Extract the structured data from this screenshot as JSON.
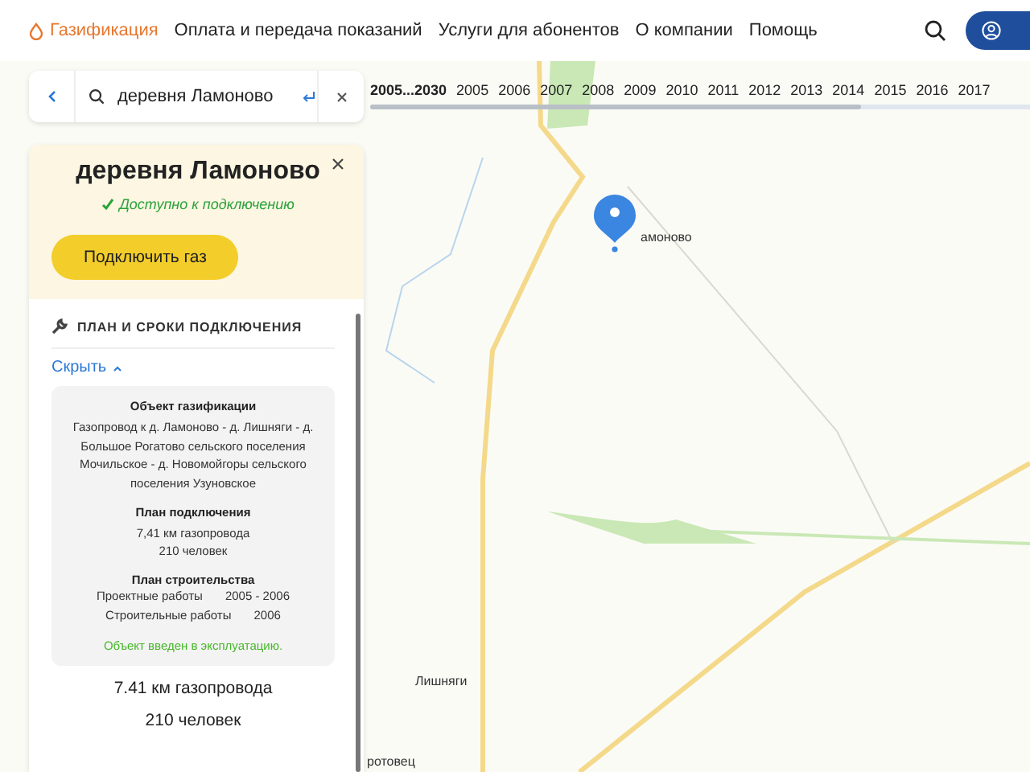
{
  "nav": {
    "items": [
      {
        "label": "Газификация",
        "selected": true
      },
      {
        "label": "Оплата и передача показаний",
        "selected": false
      },
      {
        "label": "Услуги для абонентов",
        "selected": false
      },
      {
        "label": "О компании",
        "selected": false
      },
      {
        "label": "Помощь",
        "selected": false
      }
    ]
  },
  "search": {
    "value": "деревня Ламоново"
  },
  "timeline": {
    "years": [
      {
        "label": "2005...2030",
        "selected": true
      },
      {
        "label": "2005",
        "selected": false
      },
      {
        "label": "2006",
        "selected": false
      },
      {
        "label": "2007",
        "selected": false
      },
      {
        "label": "2008",
        "selected": false
      },
      {
        "label": "2009",
        "selected": false
      },
      {
        "label": "2010",
        "selected": false
      },
      {
        "label": "2011",
        "selected": false
      },
      {
        "label": "2012",
        "selected": false
      },
      {
        "label": "2013",
        "selected": false
      },
      {
        "label": "2014",
        "selected": false
      },
      {
        "label": "2015",
        "selected": false
      },
      {
        "label": "2016",
        "selected": false
      },
      {
        "label": "2017",
        "selected": false
      }
    ]
  },
  "card": {
    "title": "деревня Ламоново",
    "status": "Доступно к подключению",
    "button": "Подключить газ",
    "section_title": "ПЛАН И СРОКИ ПОДКЛЮЧЕНИЯ",
    "toggle": "Скрыть",
    "expanded": true,
    "details": {
      "object_heading": "Объект газификации",
      "object_text": "Газопровод к д. Ламоново - д. Лишняги - д. Большое Рогатово сельского поселения Мочильское - д. Новомойгоры сельского поселения Узуновское",
      "plan_heading": "План подключения",
      "plan_lines": [
        "7,41 км газопровода",
        "210 человек"
      ],
      "build_heading": "План строительства",
      "build_rows": [
        {
          "label": "Проектные работы",
          "value": "2005 - 2006"
        },
        {
          "label": "Строительные работы",
          "value": "2006"
        }
      ],
      "note": "Объект введен в эксплуатацию."
    },
    "summary": [
      "7.41 км газопровода",
      "210 человек"
    ]
  },
  "map": {
    "labels": [
      {
        "text": "амоново"
      },
      {
        "text": "Лишняги"
      },
      {
        "text": "ротовец"
      }
    ]
  }
}
